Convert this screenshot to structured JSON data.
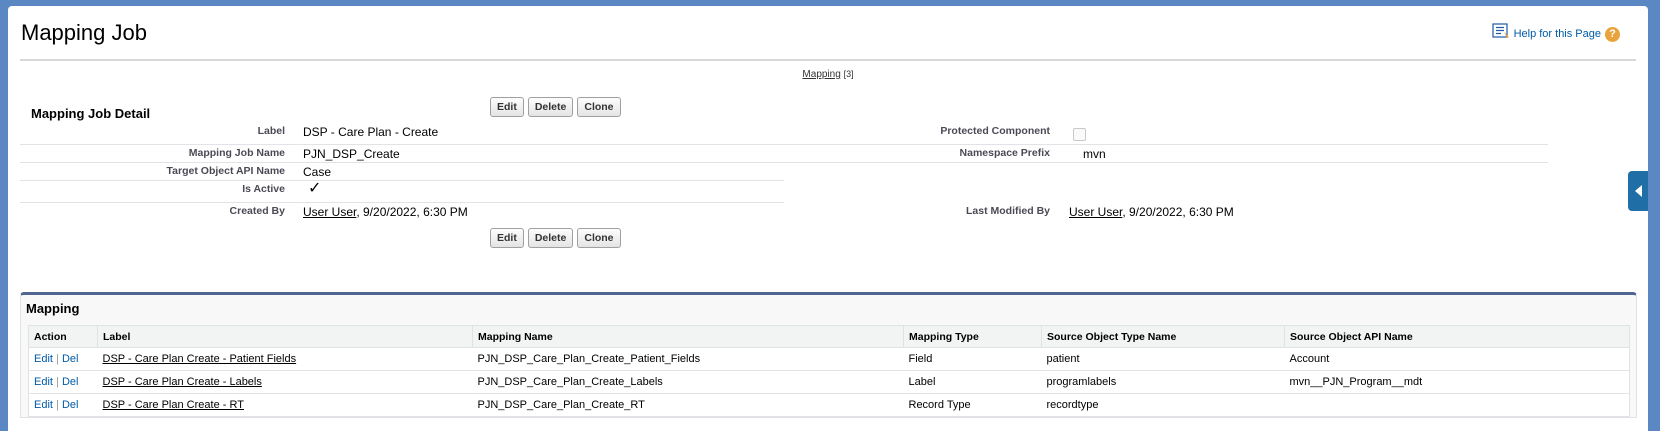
{
  "header": {
    "title": "Mapping Job",
    "help_label": "Help for this Page"
  },
  "related_links": {
    "mapping_label": "Mapping",
    "mapping_count": "[3]"
  },
  "detail": {
    "title": "Mapping Job Detail",
    "buttons": {
      "edit": "Edit",
      "delete": "Delete",
      "clone": "Clone"
    },
    "fields": {
      "label": {
        "label": "Label",
        "value": "DSP - Care Plan - Create"
      },
      "mapping_job_name": {
        "label": "Mapping Job Name",
        "value": "PJN_DSP_Create"
      },
      "target_object_api_name": {
        "label": "Target Object API Name",
        "value": "Case"
      },
      "is_active": {
        "label": "Is Active",
        "value": "✓"
      },
      "created_by": {
        "label": "Created By",
        "user": "User User",
        "date": ", 9/20/2022, 6:30 PM"
      },
      "protected_component": {
        "label": "Protected Component",
        "checked": false
      },
      "namespace_prefix": {
        "label": "Namespace Prefix",
        "value": "mvn"
      },
      "last_modified_by": {
        "label": "Last Modified By",
        "user": "User User",
        "date": ", 9/20/2022, 6:30 PM"
      }
    }
  },
  "mapping_list": {
    "title": "Mapping",
    "columns": [
      "Action",
      "Label",
      "Mapping Name",
      "Mapping Type",
      "Source Object Type Name",
      "Source Object API Name"
    ],
    "action_edit": "Edit",
    "action_sep": "|",
    "action_del": "Del",
    "rows": [
      {
        "label": "DSP - Care Plan Create - Patient Fields",
        "mapping_name": "PJN_DSP_Care_Plan_Create_Patient_Fields",
        "mapping_type": "Field",
        "source_type": "patient",
        "source_api": "Account"
      },
      {
        "label": "DSP - Care Plan Create - Labels",
        "mapping_name": "PJN_DSP_Care_Plan_Create_Labels",
        "mapping_type": "Label",
        "source_type": "programlabels",
        "source_api": "mvn__PJN_Program__mdt"
      },
      {
        "label": "DSP - Care Plan Create - RT",
        "mapping_name": "PJN_DSP_Care_Plan_Create_RT",
        "mapping_type": "Record Type",
        "source_type": "recordtype",
        "source_api": ""
      }
    ]
  },
  "colors": {
    "background": "#5b88c2",
    "link": "#015ba7",
    "related_border": "#50658f",
    "help_icon": "#e8a33d"
  }
}
